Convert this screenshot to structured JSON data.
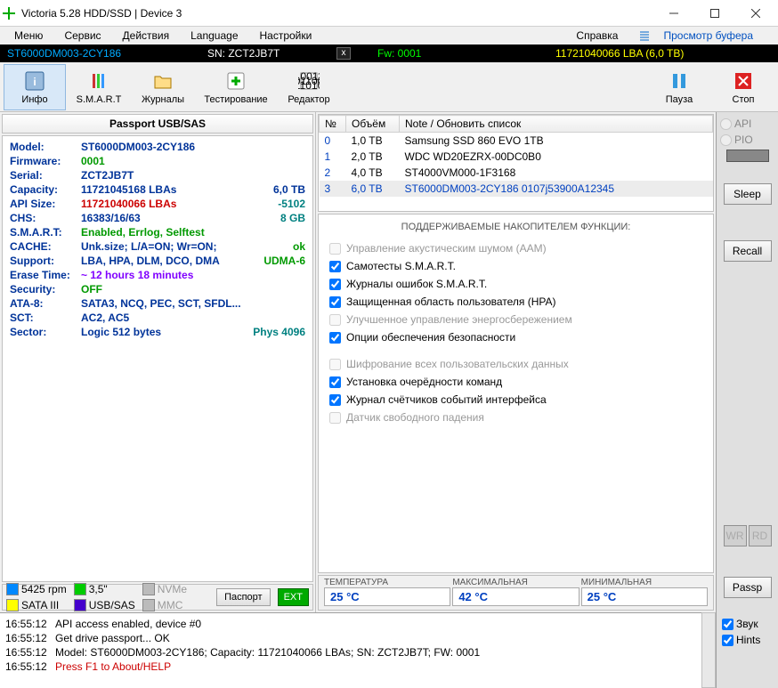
{
  "window": {
    "title": "Victoria 5.28 HDD/SSD | Device 3"
  },
  "menu": {
    "m1": "Меню",
    "m2": "Сервис",
    "m3": "Действия",
    "m4": "Language",
    "m5": "Настройки",
    "m6": "Справка",
    "m7": "Просмотр буфера"
  },
  "status": {
    "model": "ST6000DM003-2CY186",
    "sn": "SN: ZCT2JB7T",
    "fw": "Fw: 0001",
    "lba": "11721040066 LBA (6,0 TB)"
  },
  "toolbar": {
    "info": "Инфо",
    "smart": "S.M.A.R.T",
    "logs": "Журналы",
    "test": "Тестирование",
    "editor": "Редактор",
    "pause": "Пауза",
    "stop": "Стоп"
  },
  "passport_title": "Passport USB/SAS",
  "rows": {
    "model_k": "Model:",
    "model_v": "ST6000DM003-2CY186",
    "fw_k": "Firmware:",
    "fw_v": "0001",
    "serial_k": "Serial:",
    "serial_v": "ZCT2JB7T",
    "cap_k": "Capacity:",
    "cap_v": "11721045168 LBAs",
    "cap_e": "6,0 TB",
    "api_k": "API Size:",
    "api_v": "11721040066 LBAs",
    "api_e": "-5102",
    "chs_k": "CHS:",
    "chs_v": "16383/16/63",
    "chs_e": "8 GB",
    "smart_k": "S.M.A.R.T:",
    "smart_v": "Enabled, Errlog, Selftest",
    "cache_k": "CACHE:",
    "cache_v": "Unk.size; L/A=ON; Wr=ON;",
    "cache_e": "ok",
    "sup_k": "Support:",
    "sup_v": "LBA, HPA, DLM, DCO, DMA",
    "sup_e": "UDMA-6",
    "erase_k": "Erase Time:",
    "erase_v": "~ 12 hours 18 minutes",
    "sec_k": "Security:",
    "sec_v": "OFF",
    "ata_k": "ATA-8:",
    "ata_v": "SATA3, NCQ, PEC, SCT, SFDL...",
    "sct_k": "SCT:",
    "sct_v": "AC2, AC5",
    "sector_k": "Sector:",
    "sector_v": "Logic 512 bytes",
    "sector_e": "Phys 4096"
  },
  "feat": {
    "rpm": "5425 rpm",
    "size": "3,5\"",
    "nvme": "NVMe",
    "sata": "SATA III",
    "usb": "USB/SAS",
    "mmc": "MMC",
    "passport": "Паспорт",
    "ext": "EXT"
  },
  "devh": {
    "no": "№",
    "vol": "Объём",
    "note": "Note / Обновить список"
  },
  "devs": [
    {
      "n": "0",
      "v": "1,0 TB",
      "d": "Samsung SSD 860 EVO 1TB"
    },
    {
      "n": "1",
      "v": "2,0 TB",
      "d": "WDC WD20EZRX-00DC0B0"
    },
    {
      "n": "2",
      "v": "4,0 TB",
      "d": "ST4000VM000-1F3168"
    },
    {
      "n": "3",
      "v": "6,0 TB",
      "d": "ST6000DM003-2CY186      0107j53900A12345"
    }
  ],
  "func": {
    "hdr": "ПОДДЕРЖИВАЕМЫЕ НАКОПИТЕЛЕМ ФУНКЦИИ:",
    "f1": "Управление акустическим шумом (AAM)",
    "f2": "Самотесты S.M.A.R.T.",
    "f3": "Журналы ошибок S.M.A.R.T.",
    "f4": "Защищенная область пользователя (HPA)",
    "f5": "Улучшенное управление энергосбережением",
    "f6": "Опции обеспечения безопасности",
    "f7": "Шифрование всех пользовательских данных",
    "f8": "Установка очерёдности команд",
    "f9": "Журнал счётчиков событий интерфейса",
    "f10": "Датчик свободного падения"
  },
  "temp": {
    "t1l": "ТЕМПЕРАТУРА",
    "t1v": "25 °C",
    "t2l": "МАКСИМАЛЬНАЯ",
    "t2v": "42 °C",
    "t3l": "МИНИМАЛЬНАЯ",
    "t3v": "25 °C"
  },
  "side": {
    "api": "API",
    "pio": "PIO",
    "sleep": "Sleep",
    "recall": "Recall",
    "wr": "WR",
    "rd": "RD",
    "passp": "Passp",
    "sound": "Звук",
    "hints": "Hints"
  },
  "log": [
    {
      "t": "16:55:12",
      "m": "API access enabled, device #0",
      "c": ""
    },
    {
      "t": "16:55:12",
      "m": "Get drive passport... OK",
      "c": ""
    },
    {
      "t": "16:55:12",
      "m": "Model: ST6000DM003-2CY186; Capacity: 11721040066 LBAs; SN: ZCT2JB7T; FW: 0001",
      "c": ""
    },
    {
      "t": "16:55:12",
      "m": "Press F1 to About/HELP",
      "c": "red"
    }
  ]
}
